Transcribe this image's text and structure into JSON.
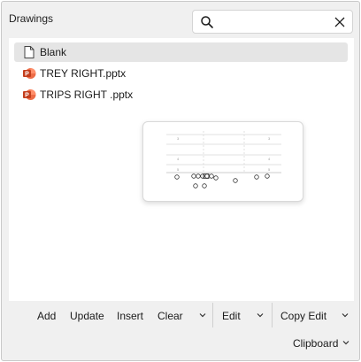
{
  "panel": {
    "title": "Drawings"
  },
  "search": {
    "value": "",
    "placeholder": ""
  },
  "items": [
    {
      "label": "Blank",
      "icon": "blank-document-icon",
      "selected": true
    },
    {
      "label": "TREY RIGHT.pptx",
      "icon": "powerpoint-icon",
      "selected": false
    },
    {
      "label": "TRIPS RIGHT .pptx",
      "icon": "powerpoint-icon",
      "selected": false
    }
  ],
  "toolbar": {
    "add_label": "Add",
    "update_label": "Update",
    "insert_label": "Insert",
    "clear_label": "Clear",
    "edit_label": "Edit",
    "copy_edit_label": "Copy Edit",
    "clipboard_label": "Clipboard"
  },
  "colors": {
    "powerpoint": "#c43e1c",
    "selection": "#e5e5e5"
  }
}
